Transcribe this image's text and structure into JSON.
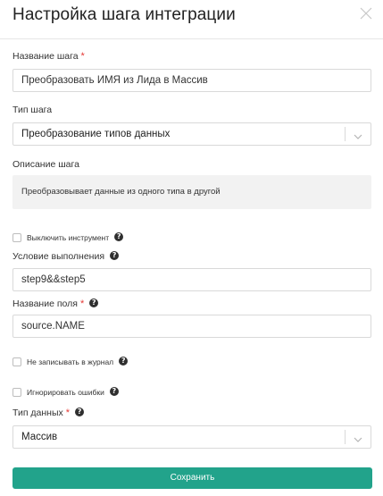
{
  "dialog": {
    "title": "Настройка шага интеграции",
    "close_icon": "close-icon"
  },
  "step_name": {
    "label": "Название шага",
    "required_mark": "*",
    "value": "Преобразовать ИМЯ из Лида в Массив"
  },
  "step_type": {
    "label": "Тип шага",
    "selected": "Преобразование типов данных"
  },
  "step_description": {
    "label": "Описание шага",
    "text": "Преобразовывает данные из одного типа в другой"
  },
  "disable_tool": {
    "label": "Выключить инструмент",
    "checked": false,
    "help_icon": "question-icon"
  },
  "execution_condition": {
    "label": "Условие выполнения",
    "value": "step9&&step5",
    "help_icon": "question-icon"
  },
  "field_name": {
    "label": "Название поля",
    "required_mark": "*",
    "value": "source.NAME",
    "help_icon": "question-icon"
  },
  "no_log": {
    "label": "Не записывать в журнал",
    "checked": false,
    "help_icon": "question-icon"
  },
  "ignore_errors": {
    "label": "Игнорировать ошибки",
    "checked": false,
    "help_icon": "question-icon"
  },
  "data_type": {
    "label": "Тип данных",
    "required_mark": "*",
    "selected": "Массив",
    "help_icon": "question-icon"
  },
  "actions": {
    "save_label": "Сохранить"
  },
  "colors": {
    "accent": "#22a38b",
    "required": "#e53935",
    "border": "#d9d9d9",
    "description_bg": "#f2f2f2"
  },
  "help_glyph": "?"
}
